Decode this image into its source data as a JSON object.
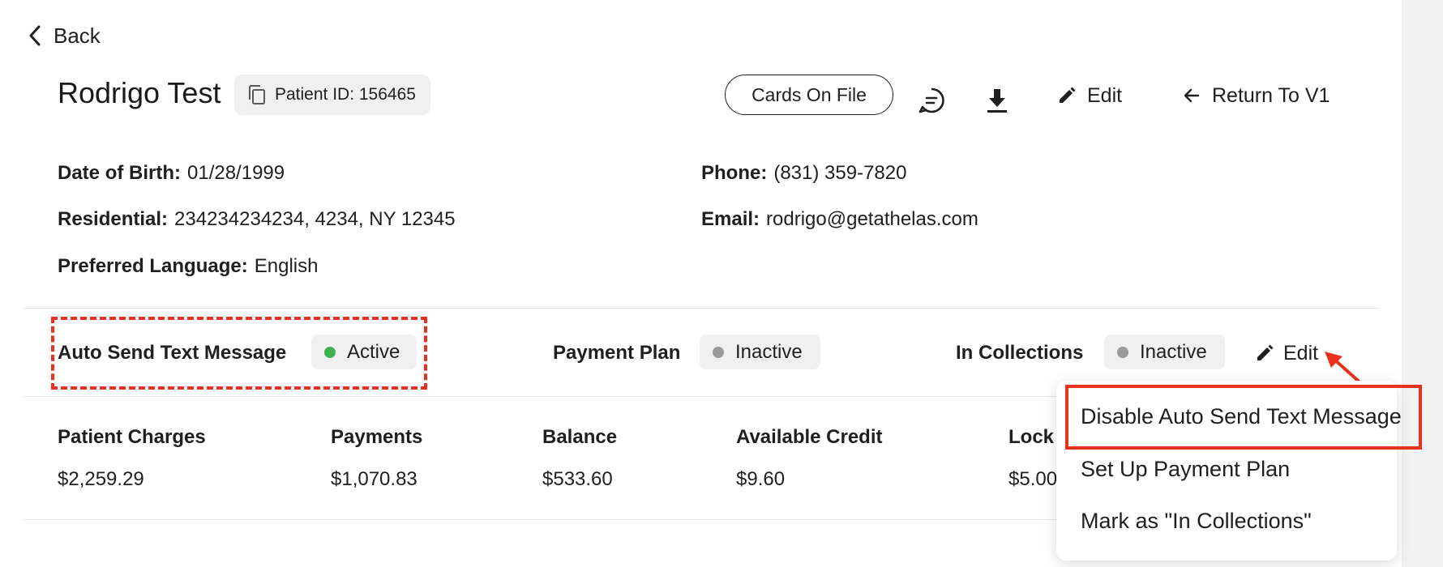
{
  "nav": {
    "back_label": "Back"
  },
  "header": {
    "patient_name": "Rodrigo Test",
    "patient_id_label": "Patient ID: 156465",
    "cards_button": "Cards On File",
    "edit_label": "Edit",
    "return_label": "Return To V1"
  },
  "info": {
    "dob": {
      "label": "Date of Birth:",
      "value": "01/28/1999"
    },
    "residential": {
      "label": "Residential:",
      "value": "234234234234, 4234, NY 12345"
    },
    "language": {
      "label": "Preferred Language:",
      "value": "English"
    },
    "phone": {
      "label": "Phone:",
      "value": "(831) 359-7820"
    },
    "email": {
      "label": "Email:",
      "value": "rodrigo@getathelas.com"
    }
  },
  "statuses": {
    "auto_text": {
      "label": "Auto Send Text Message",
      "status": "Active",
      "dot_color": "#3fb24f"
    },
    "payment_plan": {
      "label": "Payment Plan",
      "status": "Inactive",
      "dot_color": "#9a9a9a"
    },
    "collections": {
      "label": "In Collections",
      "status": "Inactive",
      "dot_color": "#9a9a9a"
    },
    "edit_label": "Edit"
  },
  "financials": [
    {
      "label": "Patient Charges",
      "value": "$2,259.29"
    },
    {
      "label": "Payments",
      "value": "$1,070.83"
    },
    {
      "label": "Balance",
      "value": "$533.60"
    },
    {
      "label": "Available Credit",
      "value": "$9.60"
    },
    {
      "label": "Lock",
      "value": "$5.00"
    }
  ],
  "dropdown": {
    "items": [
      "Disable Auto Send Text Message",
      "Set Up Payment Plan",
      "Mark as \"In Collections\""
    ]
  },
  "colors": {
    "annotation": "#e8321e",
    "active": "#3fb24f",
    "inactive": "#9a9a9a"
  }
}
